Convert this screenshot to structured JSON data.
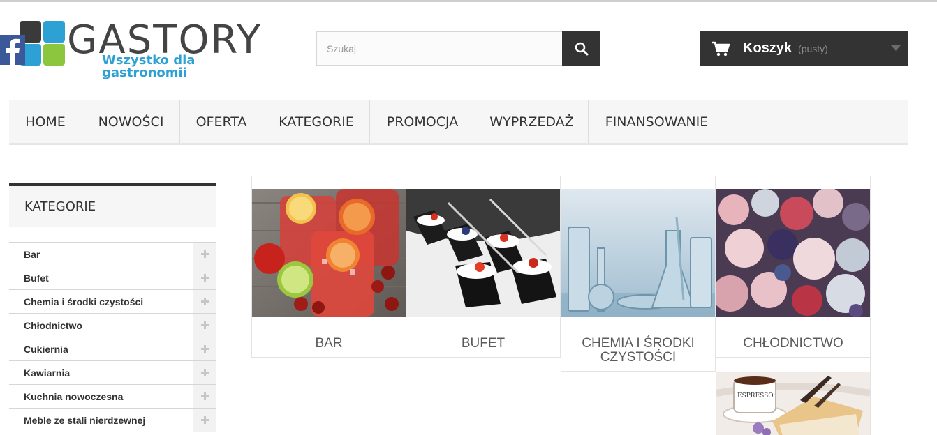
{
  "logo": {
    "brand": "GASTORY",
    "tagline": "Wszystko dla gastronomii",
    "colors": [
      "#3a3a3a",
      "#2ea1d4",
      "#8cc63f",
      "#2e6fb5"
    ]
  },
  "search": {
    "placeholder": "Szukaj",
    "value": "",
    "icon": "search-icon"
  },
  "cart": {
    "label": "Koszyk",
    "status": "(pusty)",
    "icon": "cart-icon"
  },
  "menu": {
    "items": [
      {
        "label": "HOME"
      },
      {
        "label": "NOWOŚCI"
      },
      {
        "label": "OFERTA"
      },
      {
        "label": "KATEGORIE"
      },
      {
        "label": "PROMOCJA"
      },
      {
        "label": "WYPRZEDAŻ"
      },
      {
        "label": "FINANSOWANIE"
      }
    ]
  },
  "sidebar": {
    "title": "KATEGORIE",
    "items": [
      {
        "label": "Bar"
      },
      {
        "label": "Bufet"
      },
      {
        "label": "Chemia i środki czystości"
      },
      {
        "label": "Chłodnictwo"
      },
      {
        "label": "Cukiernia"
      },
      {
        "label": "Kawiarnia"
      },
      {
        "label": "Kuchnia nowoczesna"
      },
      {
        "label": "Meble ze stali nierdzewnej"
      }
    ]
  },
  "tiles": [
    {
      "label": "BAR"
    },
    {
      "label": "BUFET"
    },
    {
      "label_line1": "CHEMIA I ŚRODKI",
      "label_line2": "CZYSTOŚCI"
    },
    {
      "label": "CHŁODNICTWO"
    }
  ],
  "tile5": {
    "cup_text": "ESPRESSO"
  },
  "colors": {
    "dark": "#333333",
    "menu_bg": "#f6f6f6",
    "logo_blue": "#2ea1d4"
  }
}
